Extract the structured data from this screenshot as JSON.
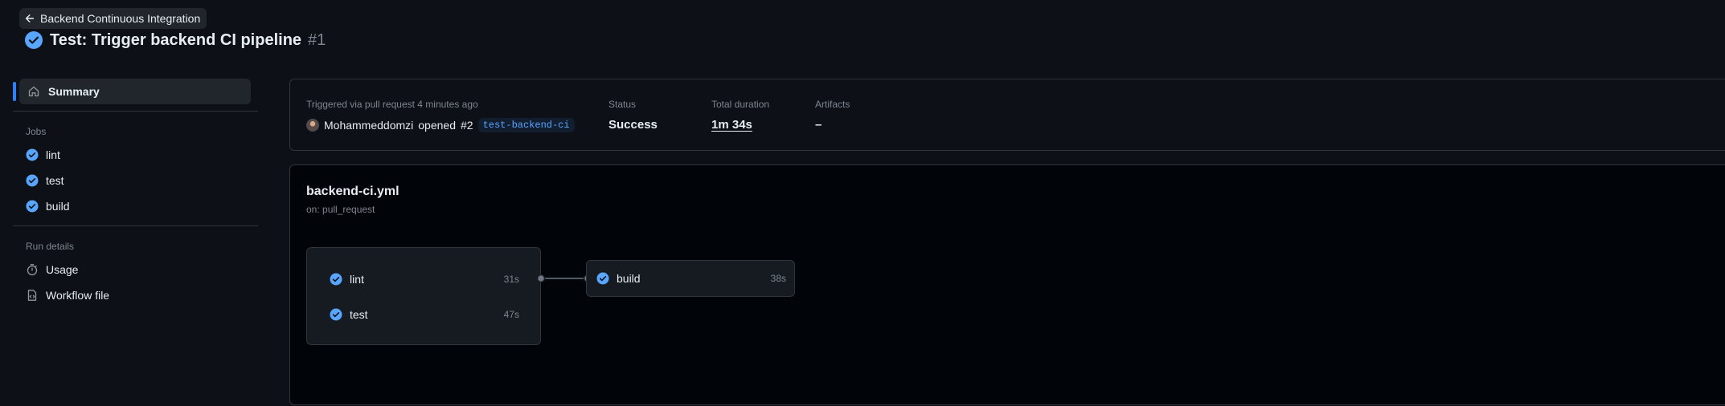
{
  "header": {
    "back_label": "Backend Continuous Integration",
    "title": "Test: Trigger backend CI pipeline",
    "run_number": "#1"
  },
  "sidebar": {
    "summary_label": "Summary",
    "jobs_section": "Jobs",
    "jobs": [
      {
        "label": "lint",
        "status": "success"
      },
      {
        "label": "test",
        "status": "success"
      },
      {
        "label": "build",
        "status": "success"
      }
    ],
    "run_details_section": "Run details",
    "usage_label": "Usage",
    "workflow_file_label": "Workflow file"
  },
  "summary": {
    "trigger_label": "Triggered via pull request 4 minutes ago",
    "actor": "Mohammeddomzi",
    "action": "opened",
    "pr": "#2",
    "branch": "test-backend-ci",
    "status_label": "Status",
    "status_value": "Success",
    "duration_label": "Total duration",
    "duration_value": "1m 34s",
    "artifacts_label": "Artifacts",
    "artifacts_value": "–"
  },
  "graph": {
    "workflow_file": "backend-ci.yml",
    "on_event": "on: pull_request",
    "group_jobs": [
      {
        "label": "lint",
        "duration": "31s"
      },
      {
        "label": "test",
        "duration": "47s"
      }
    ],
    "downstream_job": {
      "label": "build",
      "duration": "38s"
    }
  },
  "colors": {
    "background": "#0d1117",
    "success_check": "#58a6ff",
    "accent": "#2f81f7",
    "muted_text": "#7d8590",
    "border": "#30363d"
  }
}
